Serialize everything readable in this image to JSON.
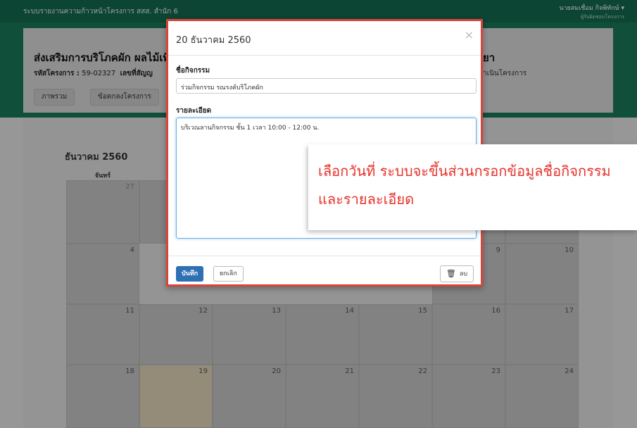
{
  "navbar": {
    "title": "ระบบรายงานความก้าวหน้าโครงการ สสส. สำนัก 6",
    "user_name": "นายสมเชื่อม กิจพิทักษ์",
    "user_role": "ผู้รับผิดชอบโครงการ"
  },
  "project": {
    "title": "ส่งเสริมการบริโภคผัก ผลไม้เพื่",
    "title_tail": "ยา",
    "code_label": "รหัสโครงการ :",
    "code_value": "59-02327",
    "contract_label": "เลขที่สัญญ",
    "meta_tail": "าเนินโครงการ",
    "tabs": [
      "ภาพรวม",
      "ข้อตกลงโครงการ"
    ]
  },
  "calendar": {
    "month": "ธันวาคม 2560",
    "weekday_first": "จันทร์",
    "row1": [
      "27"
    ],
    "row2": [
      "4",
      "9",
      "10"
    ],
    "row3": [
      "11",
      "12",
      "13",
      "14",
      "15",
      "16",
      "17"
    ],
    "row4": [
      "18",
      "19",
      "20",
      "21",
      "22",
      "23",
      "24"
    ]
  },
  "modal": {
    "title": "20 ธันวาคม 2560",
    "close": "×",
    "activity_label": "ชื่อกิจกรรม",
    "activity_value": "ร่วมกิจกรรม รณรงค์บริโภคผัก",
    "detail_label": "รายละเอียด",
    "detail_value": "บริเวณลานกิจกรรม ชั้น 1 เวลา 10:00 - 12:00 น.",
    "save_label": "บันทึก",
    "cancel_label": "ยกเลิก",
    "delete_label": "ลบ"
  },
  "callout": {
    "text": "เลือกวันที่ ระบบจะขึ้นส่วนกรอกข้อมูลชื่อกิจกรรม และรายละเอียด"
  },
  "colors": {
    "navbar": "#136a4f",
    "header": "#1a7a5a",
    "accent_red": "#e6322b",
    "primary_button": "#2f6fb3"
  }
}
